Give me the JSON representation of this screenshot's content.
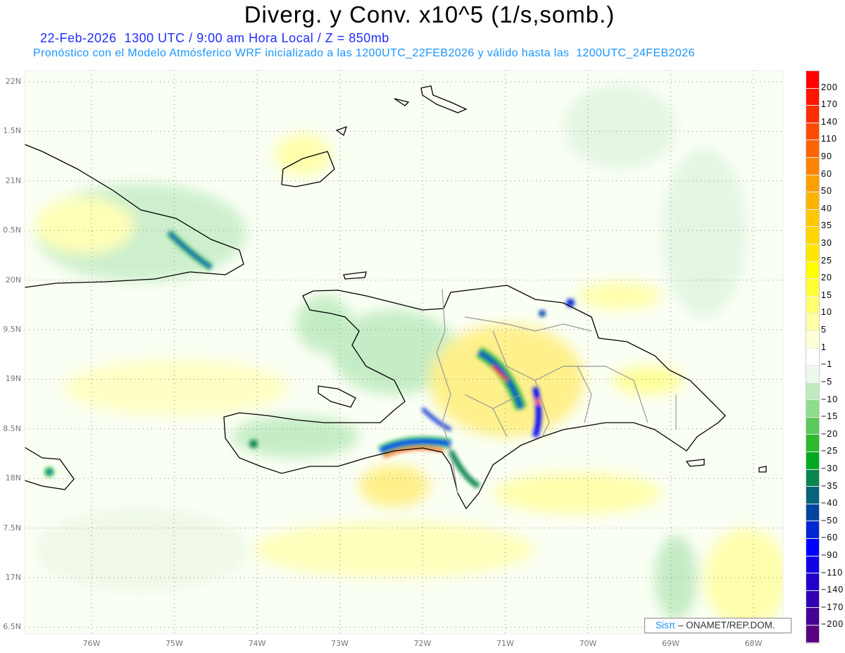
{
  "header": {
    "title": "Diverg. y Conv. x10^5 (1/s,somb.)",
    "subtitle_line1": "22-Feb-2026  1300 UTC / 9:00 am Hora Local / Z = 850mb",
    "subtitle_line2": "Pronóstico con el Modelo Atmósferico WRF inicializado a las 1200UTC_22FEB2026 y válido hasta las  1200UTC_24FEB2026"
  },
  "map": {
    "region": "Hispaniola",
    "lat_labels": [
      "22N",
      "1.5N",
      "21N",
      "0.5N",
      "20N",
      "9.5N",
      "19N",
      "8.5N",
      "18N",
      "7.5N",
      "17N",
      "6.5N"
    ],
    "lon_labels": [
      "76W",
      "75W",
      "74W",
      "73W",
      "72W",
      "71W",
      "70W",
      "69W",
      "68W"
    ],
    "grid": "dotted"
  },
  "colorbar": {
    "labels": [
      "200",
      "170",
      "140",
      "110",
      "90",
      "60",
      "50",
      "40",
      "35",
      "30",
      "25",
      "20",
      "15",
      "10",
      "5",
      "1",
      "−1",
      "−5",
      "−10",
      "−15",
      "−20",
      "−25",
      "−30",
      "−35",
      "−40",
      "−50",
      "−60",
      "−90",
      "−110",
      "−140",
      "−170",
      "−200"
    ],
    "colors": [
      "#ff0000",
      "#ff1400",
      "#ff2d00",
      "#ff4b00",
      "#ff6400",
      "#ff8200",
      "#ffa000",
      "#ffb400",
      "#ffc800",
      "#ffd700",
      "#ffe600",
      "#ffff00",
      "#ffff32",
      "#ffff6e",
      "#ffffa5",
      "#ffffd7",
      "#ffffff",
      "#edf8ed",
      "#bfebbf",
      "#8cdc8c",
      "#5ac85a",
      "#2db92d",
      "#00a820",
      "#088650",
      "#05647a",
      "#0046a0",
      "#0028d2",
      "#0000ff",
      "#1400e6",
      "#2300cd",
      "#3200b4",
      "#460096",
      "#5a0082"
    ]
  },
  "footer": {
    "brand": "Sisπ",
    "credit": "– ONAMET/REP.DOM."
  }
}
